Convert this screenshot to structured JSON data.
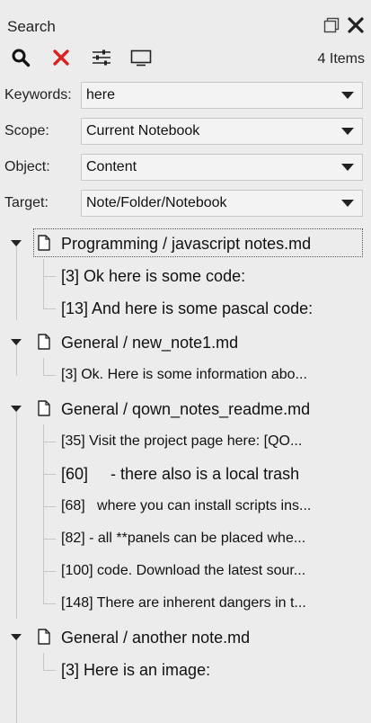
{
  "window": {
    "title": "Search"
  },
  "toolbar": {
    "search_icon": "search-icon",
    "clear_icon": "clear-icon",
    "options_icon": "sliders-icon",
    "display_icon": "monitor-icon",
    "items_count": "4 Items"
  },
  "fields": {
    "keywords": {
      "label": "Keywords:",
      "value": "here"
    },
    "scope": {
      "label": "Scope:",
      "value": "Current Notebook"
    },
    "object": {
      "label": "Object:",
      "value": "Content"
    },
    "target": {
      "label": "Target:",
      "value": "Note/Folder/Notebook"
    }
  },
  "results": [
    {
      "label": "Programming / javascript notes.md",
      "matches": [
        "[3] Ok here is some code:",
        "[13] And here is some pascal code:"
      ]
    },
    {
      "label": "General / new_note1.md",
      "matches": [
        "[3] Ok. Here is some information abo..."
      ]
    },
    {
      "label": "General / qown_notes_readme.md",
      "matches": [
        "[35] Visit the project page here: [QO...",
        "[60]     - there also is a local trash",
        "[68]   where you can install scripts ins...",
        "[82] - all **panels can be placed whe...",
        "[100] code. Download the latest sour...",
        "[148] There are inherent dangers in t..."
      ]
    },
    {
      "label": "General / another note.md",
      "matches": [
        "[3] Here is an image:"
      ]
    }
  ],
  "colors": {
    "background": "#ececec",
    "clear_red": "#e02020",
    "guide": "#c6c6c6"
  }
}
